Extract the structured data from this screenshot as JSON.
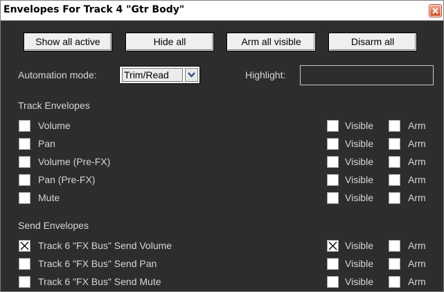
{
  "window": {
    "title": "Envelopes For Track 4 \"Gtr Body\""
  },
  "toolbar": {
    "show_all_active": "Show all active",
    "hide_all": "Hide all",
    "arm_all_visible": "Arm all visible",
    "disarm_all": "Disarm all"
  },
  "automation": {
    "label": "Automation mode:",
    "value": "Trim/Read"
  },
  "highlight": {
    "label": "Highlight:",
    "value": ""
  },
  "track_envelopes": {
    "heading": "Track Envelopes",
    "items": [
      {
        "label": "Volume",
        "checked": false,
        "visible_label": "Visible",
        "visible": false,
        "arm_label": "Arm",
        "arm": false
      },
      {
        "label": "Pan",
        "checked": false,
        "visible_label": "Visible",
        "visible": false,
        "arm_label": "Arm",
        "arm": false
      },
      {
        "label": "Volume (Pre-FX)",
        "checked": false,
        "visible_label": "Visible",
        "visible": false,
        "arm_label": "Arm",
        "arm": false
      },
      {
        "label": "Pan (Pre-FX)",
        "checked": false,
        "visible_label": "Visible",
        "visible": false,
        "arm_label": "Arm",
        "arm": false
      },
      {
        "label": "Mute",
        "checked": false,
        "visible_label": "Visible",
        "visible": false,
        "arm_label": "Arm",
        "arm": false
      }
    ]
  },
  "send_envelopes": {
    "heading": "Send Envelopes",
    "items": [
      {
        "label": "Track 6 \"FX Bus\" Send Volume",
        "checked": true,
        "visible_label": "Visible",
        "visible": true,
        "arm_label": "Arm",
        "arm": false
      },
      {
        "label": "Track 6 \"FX Bus\" Send Pan",
        "checked": false,
        "visible_label": "Visible",
        "visible": false,
        "arm_label": "Arm",
        "arm": false
      },
      {
        "label": "Track 6 \"FX Bus\" Send Mute",
        "checked": false,
        "visible_label": "Visible",
        "visible": false,
        "arm_label": "Arm",
        "arm": false
      }
    ]
  },
  "colors": {
    "panel_background": "#2d2d2d",
    "text": "#d6d6d6",
    "close_button": "#d5532b"
  }
}
